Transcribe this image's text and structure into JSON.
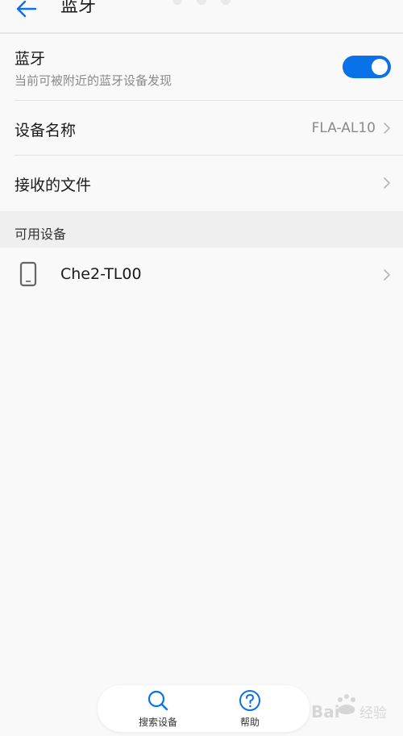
{
  "header": {
    "title": "蓝牙"
  },
  "bluetooth": {
    "title": "蓝牙",
    "subtitle": "当前可被附近的蓝牙设备发现",
    "enabled": true
  },
  "device_name": {
    "label": "设备名称",
    "value": "FLA-AL10"
  },
  "received_files": {
    "label": "接收的文件"
  },
  "available_devices": {
    "section_title": "可用设备",
    "items": [
      {
        "name": "Che2-TL00",
        "icon": "phone-icon"
      }
    ]
  },
  "bottom_bar": {
    "search_label": "搜索设备",
    "help_label": "帮助"
  },
  "watermark": {
    "text": "Bai 经验"
  },
  "colors": {
    "accent": "#0a72e8",
    "background": "#f9f9f9",
    "section_bg": "#efefef"
  }
}
